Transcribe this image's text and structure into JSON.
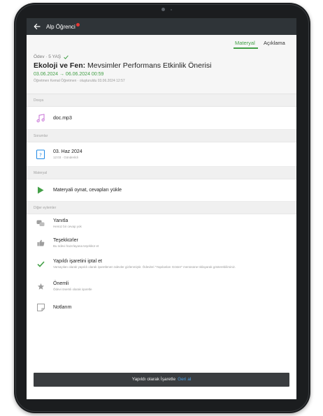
{
  "header": {
    "title": "Alp Öğrenci"
  },
  "tabs": [
    {
      "label": "Materyal",
      "active": true
    },
    {
      "label": "Açıklama",
      "active": false
    }
  ],
  "assignment": {
    "meta": "Ödev · 5 YAŞ",
    "title_bold": "Ekoloji ve Fen:",
    "title_rest": " Mevsimler Performans Etkinlik Önerisi",
    "dates": "03.06.2024 → 06.06.2024 00:59",
    "teacher_line": "Öğretmen Kemal Öğretmen · oluşturuldu 03.06.2024 12:57"
  },
  "sections": {
    "files": "Dosya",
    "dates": "Sorumlar",
    "material": "Materyal",
    "other": "Diğer eylemler"
  },
  "file": {
    "name": "doc.mp3",
    "icon": "music-note-icon"
  },
  "due": {
    "date": "03. Haz 2024",
    "sub": "12:03 · Gönderildi"
  },
  "material_action": "Materyali oynat, cevapları yükle",
  "actions": [
    {
      "label": "Yanıtla",
      "sub": "Henüz bir cevap yok",
      "icon": "chat-bubbles-icon"
    },
    {
      "label": "Teşekkürler",
      "sub": "Bu ödevi hazırlayana teşekkür et",
      "icon": "thumbs-up-icon"
    },
    {
      "label": "Yapıldı işaretini iptal et",
      "sub": "Varsayılan olarak yapıldı olarak işaretlenen ödevler gizlenmiştir. Ödevleri \"Yapılanları Göster\" menüsüne tıklayarak gösterebilirsiniz.",
      "icon": "check-icon"
    },
    {
      "label": "Önemli",
      "sub": "Ödevi önemli olarak işaretle",
      "icon": "star-icon"
    },
    {
      "label": "Notlarım",
      "sub": "",
      "icon": "note-icon"
    }
  ],
  "snackbar": {
    "text": "Yapıldı olarak İşaretle",
    "action": "Geri al"
  },
  "colors": {
    "accent": "#43a047",
    "appbar": "#2f3438",
    "link": "#4da3e8",
    "notification": "#e53935"
  }
}
